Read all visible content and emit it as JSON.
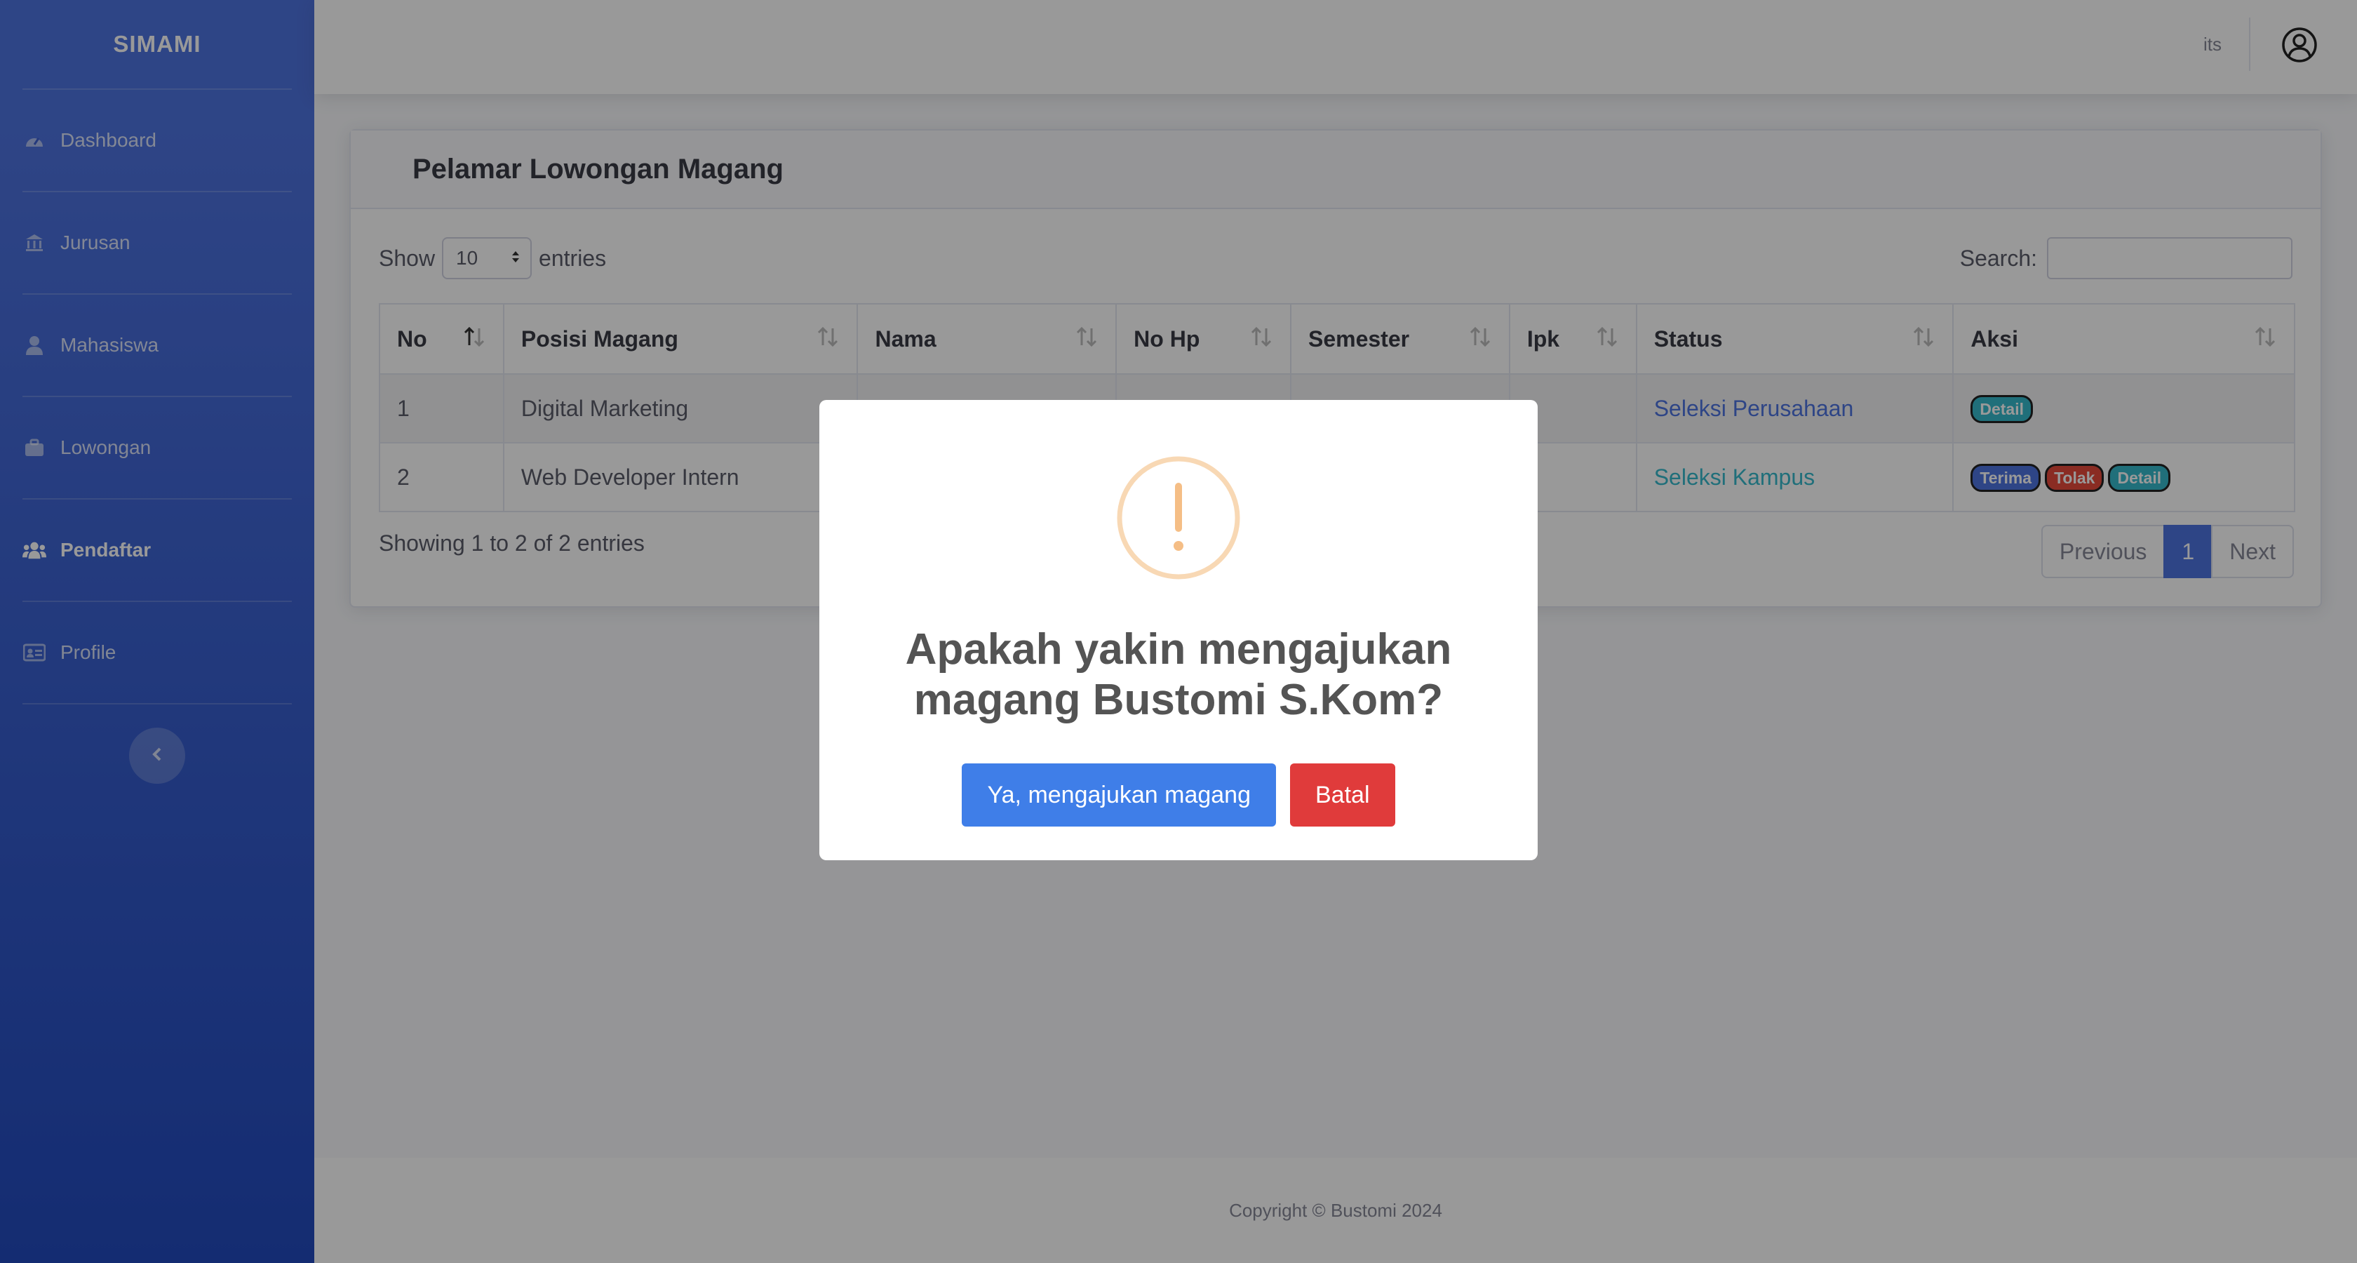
{
  "app": {
    "brand": "SIMAMI"
  },
  "sidebar": {
    "items": [
      {
        "label": "Dashboard",
        "icon": "tachometer-icon",
        "active": false
      },
      {
        "label": "Jurusan",
        "icon": "university-icon",
        "active": false
      },
      {
        "label": "Mahasiswa",
        "icon": "user-icon",
        "active": false
      },
      {
        "label": "Lowongan",
        "icon": "briefcase-icon",
        "active": false
      },
      {
        "label": "Pendaftar",
        "icon": "users-icon",
        "active": true
      },
      {
        "label": "Profile",
        "icon": "id-card-icon",
        "active": false
      }
    ],
    "toggle_icon": "chevron-left-icon"
  },
  "topbar": {
    "username": "its",
    "avatar_icon": "user-circle-icon"
  },
  "card": {
    "title": "Pelamar Lowongan Magang"
  },
  "table_controls": {
    "show_label": "Show",
    "entries_value": "10",
    "entries_label": "entries",
    "search_label": "Search:",
    "search_placeholder": ""
  },
  "table": {
    "columns": [
      "No",
      "Posisi Magang",
      "Nama",
      "No Hp",
      "Semester",
      "Ipk",
      "Status",
      "Aksi"
    ],
    "rows": [
      {
        "no": "1",
        "posisi": "Digital Marketing",
        "nama": "",
        "nohp": "",
        "semester": "",
        "ipk": "",
        "status": "Seleksi Perusahaan",
        "actions": [
          "Detail"
        ]
      },
      {
        "no": "2",
        "posisi": "Web Developer Intern",
        "nama": "",
        "nohp": "",
        "semester": "",
        "ipk": "",
        "status": "Seleksi Kampus",
        "actions": [
          "Terima",
          "Tolak",
          "Detail"
        ]
      }
    ]
  },
  "pagination": {
    "info": "Showing 1 to 2 of 2 entries",
    "previous": "Previous",
    "current": "1",
    "next": "Next"
  },
  "footer": {
    "text": "Copyright © Bustomi 2024"
  },
  "modal": {
    "icon": "warning-icon",
    "title": "Apakah yakin mengajukan magang Bustomi S.Kom?",
    "confirm_label": "Ya, mengajukan magang",
    "cancel_label": "Batal"
  },
  "colors": {
    "primary": "#4e73df",
    "info": "#36b9cc",
    "danger": "#e74a3b",
    "warning": "#f8bb86"
  }
}
